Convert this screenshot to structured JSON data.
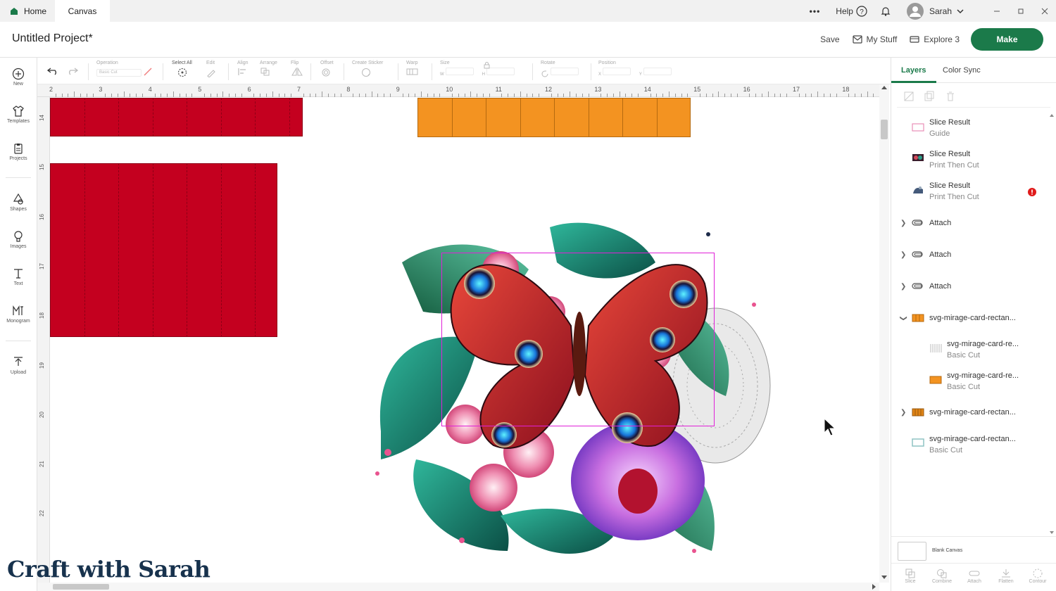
{
  "tabs": {
    "home": "Home",
    "canvas": "Canvas"
  },
  "titlebar": {
    "help": "Help",
    "user": "Sarah",
    "more": "•••"
  },
  "header": {
    "project_title": "Untitled Project*",
    "save": "Save",
    "my_stuff": "My Stuff",
    "machine": "Explore 3",
    "make": "Make"
  },
  "rail": [
    {
      "label": "New"
    },
    {
      "label": "Templates"
    },
    {
      "label": "Projects"
    },
    {
      "label": "Shapes"
    },
    {
      "label": "Images"
    },
    {
      "label": "Text"
    },
    {
      "label": "Monogram"
    },
    {
      "label": "Upload"
    }
  ],
  "toolbar": {
    "operation": "Operation",
    "operation_value": "Basic Cut",
    "select_all": "Select All",
    "edit": "Edit",
    "align": "Align",
    "arrange": "Arrange",
    "flip": "Flip",
    "offset": "Offset",
    "create_sticker": "Create Sticker",
    "warp": "Warp",
    "size": "Size",
    "w": "W",
    "h": "H",
    "rotate": "Rotate",
    "position": "Position",
    "x": "X",
    "y": "Y"
  },
  "ruler_top": [
    "2",
    "3",
    "4",
    "5",
    "6",
    "7",
    "8",
    "9",
    "10",
    "11",
    "12",
    "13",
    "14",
    "15",
    "16",
    "17",
    "18"
  ],
  "ruler_left": [
    "14",
    "15",
    "16",
    "17",
    "18",
    "19",
    "20",
    "21",
    "22"
  ],
  "panel": {
    "tab_layers": "Layers",
    "tab_color_sync": "Color Sync",
    "layers": [
      {
        "name": "Slice Result",
        "sub": "Guide"
      },
      {
        "name": "Slice Result",
        "sub": "Print Then Cut"
      },
      {
        "name": "Slice Result",
        "sub": "Print Then Cut"
      },
      {
        "name": "Attach"
      },
      {
        "name": "Attach"
      },
      {
        "name": "Attach"
      },
      {
        "name": "svg-mirage-card-rectan..."
      },
      {
        "name": "svg-mirage-card-re...",
        "sub": "Basic Cut"
      },
      {
        "name": "svg-mirage-card-re...",
        "sub": "Basic Cut"
      },
      {
        "name": "svg-mirage-card-rectan..."
      },
      {
        "name": "svg-mirage-card-rectan...",
        "sub": "Basic Cut"
      }
    ],
    "blank_canvas": "Blank Canvas",
    "bottom": [
      "Slice",
      "Combine",
      "Attach",
      "Flatten",
      "Contour"
    ]
  },
  "colors": {
    "make": "#1b7a4a",
    "red_tile": "#c4001f",
    "orange_tile": "#f39321",
    "selection": "#e020d8"
  },
  "brand": "Craft with Sarah"
}
